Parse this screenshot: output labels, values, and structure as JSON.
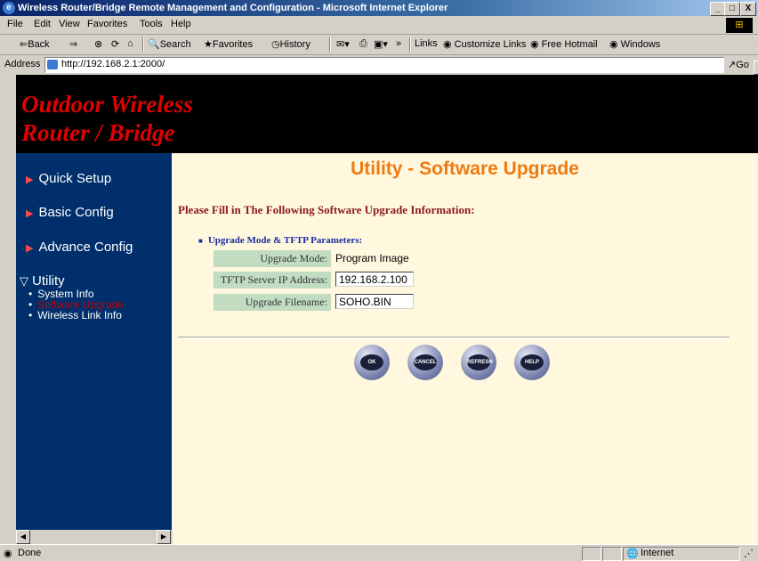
{
  "window": {
    "title": "Wireless Router/Bridge Remote Management and Configuration - Microsoft Internet Explorer",
    "controls": [
      "_",
      "□",
      "X"
    ]
  },
  "menu": [
    "File",
    "Edit",
    "View",
    "Favorites",
    "Tools",
    "Help"
  ],
  "toolbar": {
    "back": "⇐Back",
    "forward": "⇒",
    "search": "Search",
    "favorites": "Favorites",
    "history": "History",
    "more": "»",
    "links_label": "Links",
    "links": [
      "Customize Links",
      "Free Hotmail",
      "Windows"
    ]
  },
  "address": {
    "label": "Address",
    "url": "http://192.168.2.1:2000/",
    "go": "Go"
  },
  "banner": {
    "line1": "Outdoor Wireless",
    "line2": "Router / Bridge"
  },
  "sidebar": {
    "items": [
      {
        "label": "Quick Setup",
        "arrow": "▶"
      },
      {
        "label": "Basic Config",
        "arrow": "▶"
      },
      {
        "label": "Advance Config",
        "arrow": "▶"
      },
      {
        "label": "Utility",
        "arrow": "▽"
      }
    ],
    "subitems": [
      {
        "label": "System Info",
        "active": false
      },
      {
        "label": "Software Upgrade",
        "active": true
      },
      {
        "label": "Wireless Link Info",
        "active": false
      }
    ]
  },
  "main": {
    "title": "Utility - Software Upgrade",
    "subtitle": "Please Fill in The Following Software Upgrade Information:",
    "section": "Upgrade Mode & TFTP Parameters:",
    "fields": [
      {
        "label": "Upgrade Mode:",
        "value": "Program Image"
      },
      {
        "label": "TFTP Server IP Address:",
        "value": "192.168.2.100"
      },
      {
        "label": "Upgrade Filename:",
        "value": "SOHO.BIN"
      }
    ],
    "buttons": [
      "OK",
      "CANCEL",
      "REFRESH",
      "HELP"
    ]
  },
  "status": {
    "left": "Done",
    "zone": "Internet"
  },
  "colors": {
    "sidebar_bg": "#002f6c",
    "main_bg": "#fff8df",
    "title_orange": "#ef7a10",
    "banner_red": "#e00000",
    "label_green": "#c2dcc2"
  }
}
